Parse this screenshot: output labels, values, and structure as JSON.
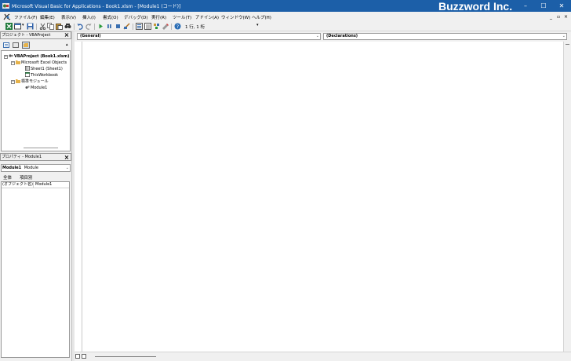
{
  "window": {
    "title": "Microsoft Visual Basic for Applications - Book1.xlsm - [Module1 (コード)]",
    "watermark": "Buzzword Inc.",
    "controls": {
      "minimize": "–",
      "maximize": "☐",
      "close": "✕"
    },
    "accent_color": "#1c5fa8"
  },
  "menubar": {
    "items": [
      "ファイル(F)",
      "編集(E)",
      "表示(V)",
      "挿入(I)",
      "書式(O)",
      "デバッグ(D)",
      "実行(R)",
      "ツール(T)",
      "アドイン(A)",
      "ウィンドウ(W)",
      "ヘルプ(H)"
    ],
    "mdi_controls": {
      "minimize": "_",
      "restore": "▫",
      "close": "×"
    }
  },
  "toolbar": {
    "position_text": "1 行, 1 桁",
    "icons": [
      "excel-icon",
      "insert-module-icon",
      "save-icon",
      "cut-icon",
      "copy-icon",
      "paste-icon",
      "find-icon",
      "undo-icon",
      "redo-icon",
      "run-icon",
      "break-icon",
      "reset-icon",
      "design-mode-icon",
      "project-explorer-icon",
      "properties-icon",
      "object-browser-icon",
      "toolbox-icon",
      "help-icon"
    ]
  },
  "project_pane": {
    "title": "プロジェクト - VBAProject",
    "close": "×",
    "tree": {
      "project": "VBAProject (Book1.xlsm)",
      "excel_objects_folder": "Microsoft Excel Objects",
      "sheet1": "Sheet1 (Sheet1)",
      "thisworkbook": "ThisWorkbook",
      "modules_folder": "標準モジュール",
      "module1": "Module1"
    }
  },
  "properties_pane": {
    "title": "プロパティ - Module1",
    "close": "×",
    "object_name": "Module1",
    "object_type": "Module",
    "tabs": [
      "全体",
      "項目別"
    ],
    "rows": [
      {
        "name": "(オブジェクト名)",
        "value": "Module1"
      }
    ]
  },
  "code_window": {
    "object_combo": "(General)",
    "procedure_combo": "(Declarations)"
  }
}
